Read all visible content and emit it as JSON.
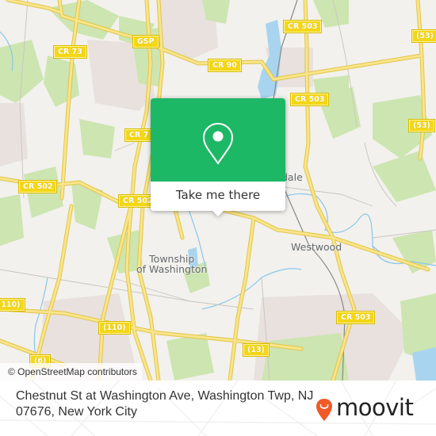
{
  "map": {
    "attribution": "© OpenStreetMap contributors",
    "colors": {
      "land": "#f2f1ed",
      "green": "#cde5b0",
      "water": "#a8d4ef",
      "road": "#f6e27a",
      "road_casing": "#e8c84a",
      "urban": "#e8e1de",
      "shield": "#f4d716"
    },
    "road_shields": [
      {
        "id": "cr73",
        "label": "CR 73"
      },
      {
        "id": "gsp",
        "label": "GSP"
      },
      {
        "id": "cr90",
        "label": "CR 90"
      },
      {
        "id": "cr503-top",
        "label": "CR 503"
      },
      {
        "id": "cr503-mid",
        "label": "CR 503"
      },
      {
        "id": "cr503-bottom",
        "label": "CR 503"
      },
      {
        "id": "r53-top",
        "label": "(53)"
      },
      {
        "id": "r53-mid",
        "label": "(53)"
      },
      {
        "id": "cr7",
        "label": "CR 7"
      },
      {
        "id": "cr502-left",
        "label": "CR 502"
      },
      {
        "id": "cr502-mid",
        "label": "CR 502"
      },
      {
        "id": "r110-left",
        "label": "(110)"
      },
      {
        "id": "r110-mid",
        "label": "(110)"
      },
      {
        "id": "r13",
        "label": "(13)"
      },
      {
        "id": "r6",
        "label": "(6)"
      }
    ],
    "places": [
      {
        "id": "township",
        "line1": "Township",
        "line2": "of Washington"
      },
      {
        "id": "westwood",
        "line1": "Westwood",
        "line2": ""
      },
      {
        "id": "hillsdale",
        "line1": "dale",
        "line2": ""
      }
    ]
  },
  "popup": {
    "icon": "map-pin-icon",
    "button_label": "Take me there",
    "color": "#1db865"
  },
  "footer": {
    "address": "Chestnut St at Washington Ave, Washington Twp, NJ 07676, New York City",
    "brand": "moovit",
    "brand_color": "#f05a28"
  }
}
